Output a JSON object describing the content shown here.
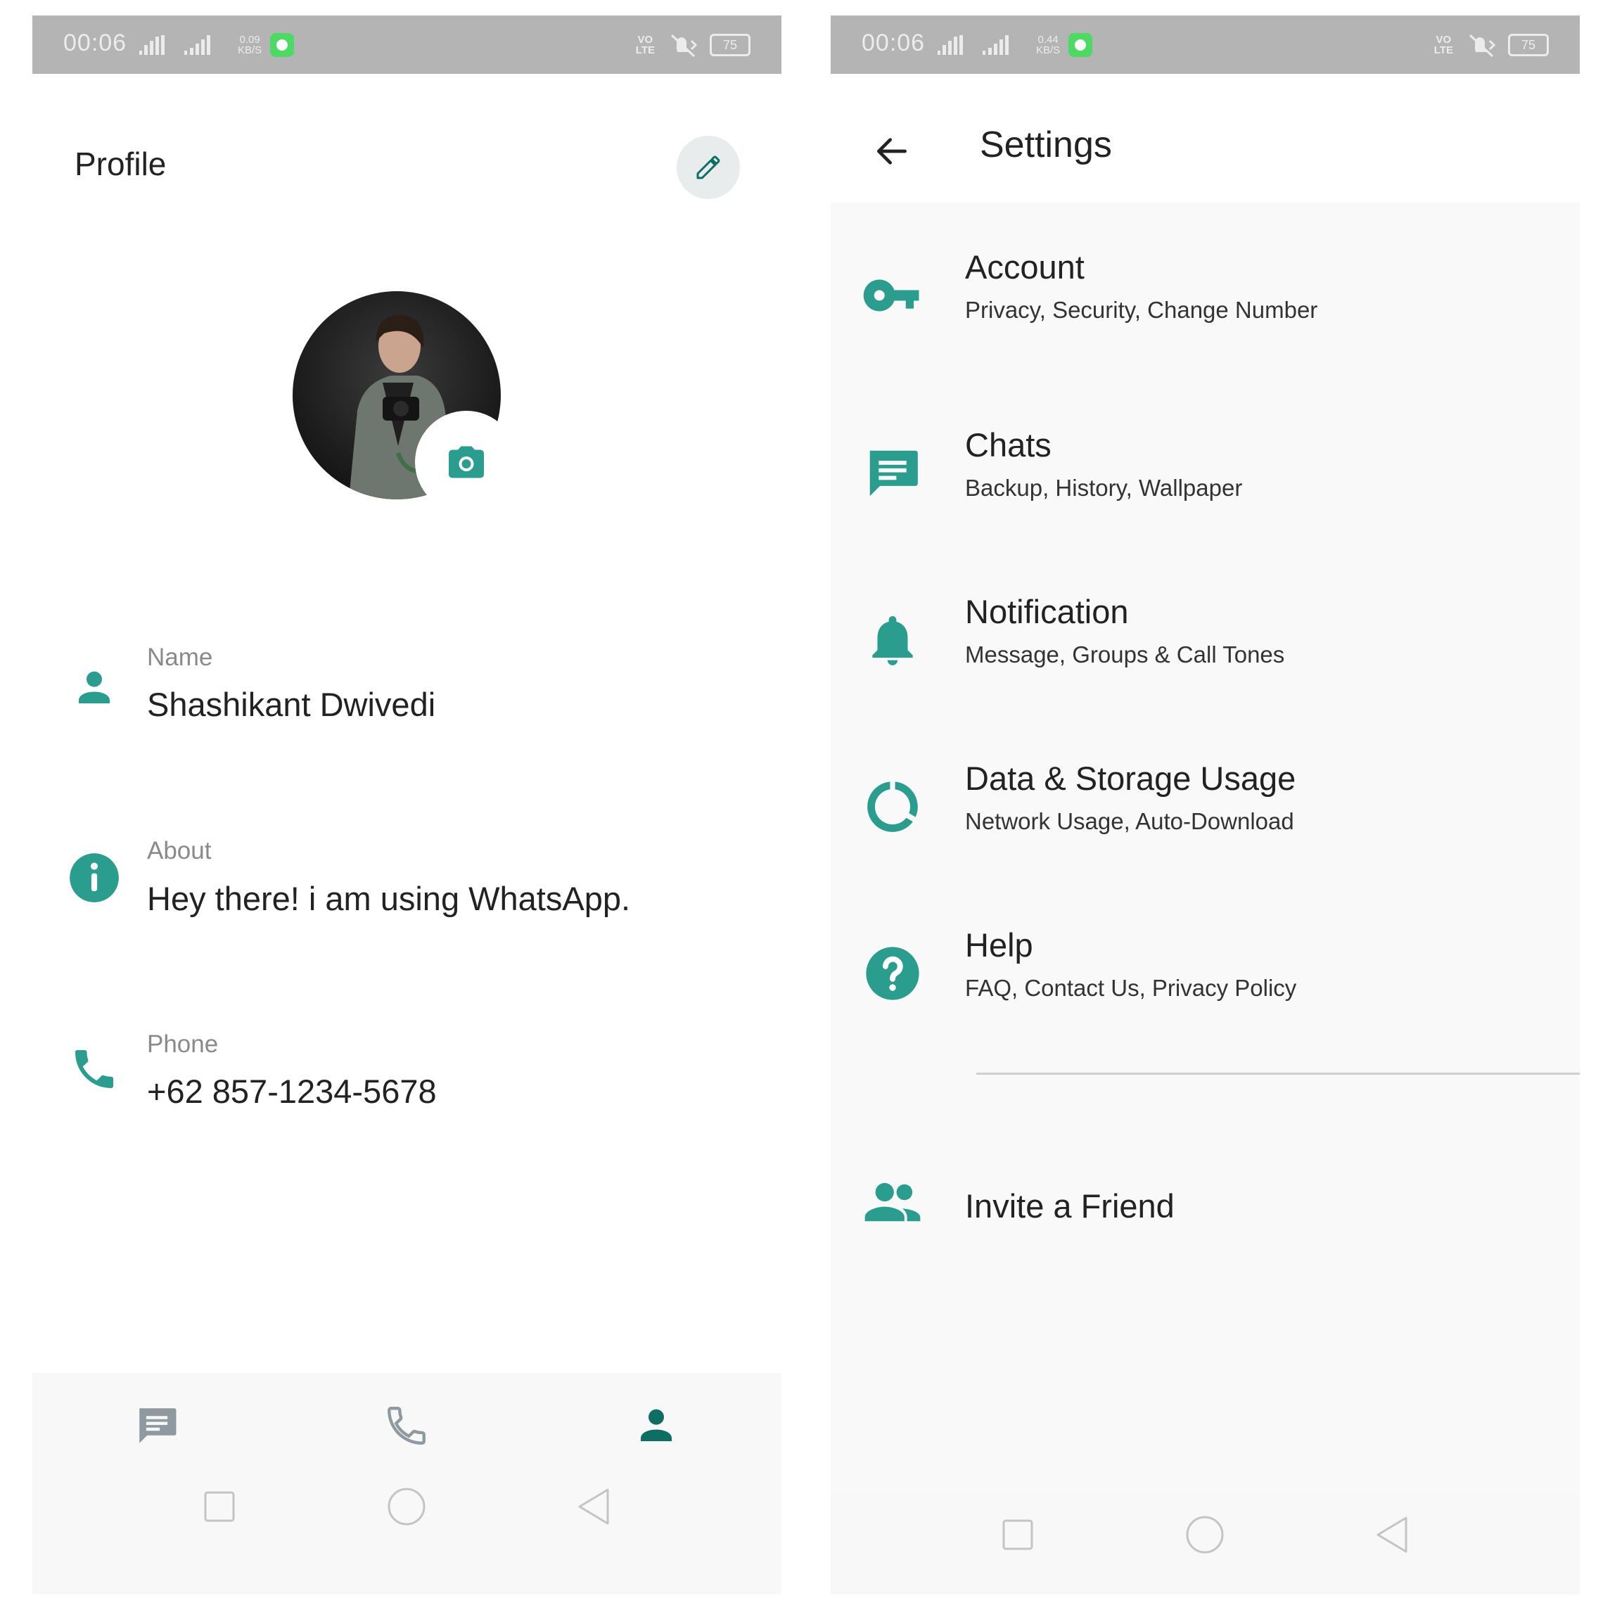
{
  "colors": {
    "accent": "#2a9d8f",
    "accent_dark": "#0e6e63",
    "statusbar": "#b4b4b4",
    "inactive_icon": "#8e9aa0"
  },
  "left": {
    "status": {
      "time": "00:06",
      "speed_top": "0.09",
      "speed_bottom": "KB/S",
      "volte_top": "VO",
      "volte_bottom": "LTE",
      "battery": "75"
    },
    "title": "Profile",
    "fields": [
      {
        "icon": "person-icon",
        "label": "Name",
        "value": "Shashikant Dwivedi"
      },
      {
        "icon": "info-icon",
        "label": "About",
        "value": "Hey there! i am using WhatsApp."
      },
      {
        "icon": "phone-icon",
        "label": "Phone",
        "value": "+62 857-1234-5678"
      }
    ],
    "tabs": [
      {
        "icon": "chat-icon",
        "active": false
      },
      {
        "icon": "call-icon",
        "active": false
      },
      {
        "icon": "profile-icon",
        "active": true
      }
    ]
  },
  "right": {
    "status": {
      "time": "00:06",
      "speed_top": "0.44",
      "speed_bottom": "KB/S",
      "volte_top": "VO",
      "volte_bottom": "LTE",
      "battery": "75"
    },
    "title": "Settings",
    "items": [
      {
        "icon": "key-icon",
        "name": "Account",
        "sub": "Privacy, Security, Change Number"
      },
      {
        "icon": "chat-icon",
        "name": "Chats",
        "sub": "Backup, History, Wallpaper"
      },
      {
        "icon": "bell-icon",
        "name": "Notification",
        "sub": "Message, Groups & Call Tones"
      },
      {
        "icon": "data-usage-icon",
        "name": "Data & Storage Usage",
        "sub": "Network Usage, Auto-Download"
      },
      {
        "icon": "help-icon",
        "name": "Help",
        "sub": "FAQ, Contact Us, Privacy Policy"
      }
    ],
    "invite": {
      "icon": "group-icon",
      "label": "Invite a Friend"
    }
  }
}
